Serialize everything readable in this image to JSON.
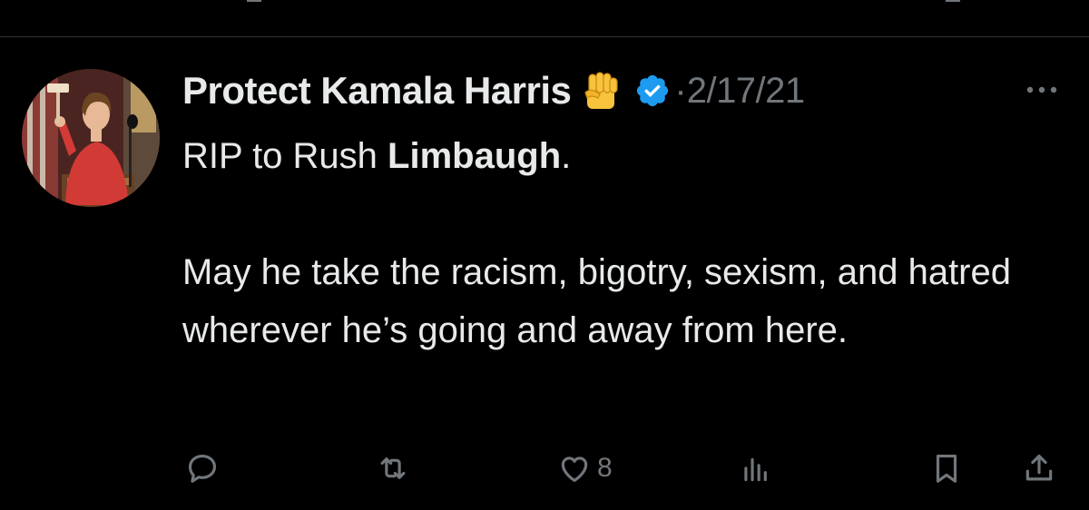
{
  "tweet": {
    "display_name": "Protect Kamala Harris",
    "name_emoji": "raised-fist-icon",
    "verified": "verified-badge-icon",
    "separator": "·",
    "timestamp": "2/17/21",
    "body": {
      "line1_prefix": "RIP to Rush ",
      "line1_bold": "Limbaugh",
      "line1_suffix": ".",
      "paragraph2": "May he take the racism, bigotry, sexism, and hatred wherever he’s going and away from here."
    }
  },
  "actions": {
    "reply": "reply-icon",
    "retweet": "retweet-icon",
    "like": "heart-icon",
    "like_count": "8",
    "views": "views-icon",
    "bookmark": "bookmark-icon",
    "share": "share-icon"
  },
  "colors": {
    "background": "#000000",
    "text_primary": "#e7e9ea",
    "text_secondary": "#71767b",
    "verified_blue": "#1d9bf0",
    "divider": "#2f3336",
    "fist_yellow": "#f7c23c"
  }
}
